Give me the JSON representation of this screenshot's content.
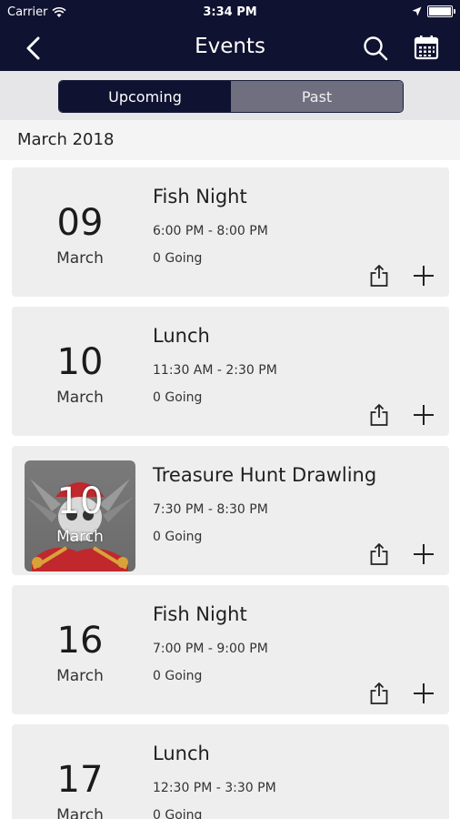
{
  "status_bar": {
    "carrier": "Carrier",
    "time": "3:34 PM"
  },
  "nav": {
    "title": "Events"
  },
  "segments": {
    "upcoming": "Upcoming",
    "past": "Past",
    "selected": "Upcoming"
  },
  "section": {
    "month": "March 2018"
  },
  "events": [
    {
      "day": "09",
      "month": "March",
      "title": "Fish Night",
      "time": "6:00 PM - 8:00 PM",
      "going": "0 Going"
    },
    {
      "day": "10",
      "month": "March",
      "title": "Lunch",
      "time": "11:30 AM - 2:30 PM",
      "going": "0 Going"
    },
    {
      "day": "10",
      "month": "March",
      "title": "Treasure Hunt Drawling",
      "time": "7:30 PM - 8:30 PM",
      "going": "0 Going",
      "image": "pirate-skull-image"
    },
    {
      "day": "16",
      "month": "March",
      "title": "Fish Night",
      "time": "7:00 PM - 9:00 PM",
      "going": "0 Going"
    },
    {
      "day": "17",
      "month": "March",
      "title": "Lunch",
      "time": "12:30 PM - 3:30 PM",
      "going": "0 Going"
    }
  ],
  "colors": {
    "nav_background": "#0f1230",
    "segment_inactive": "#6f6f80",
    "card_background": "#eeeeef"
  }
}
